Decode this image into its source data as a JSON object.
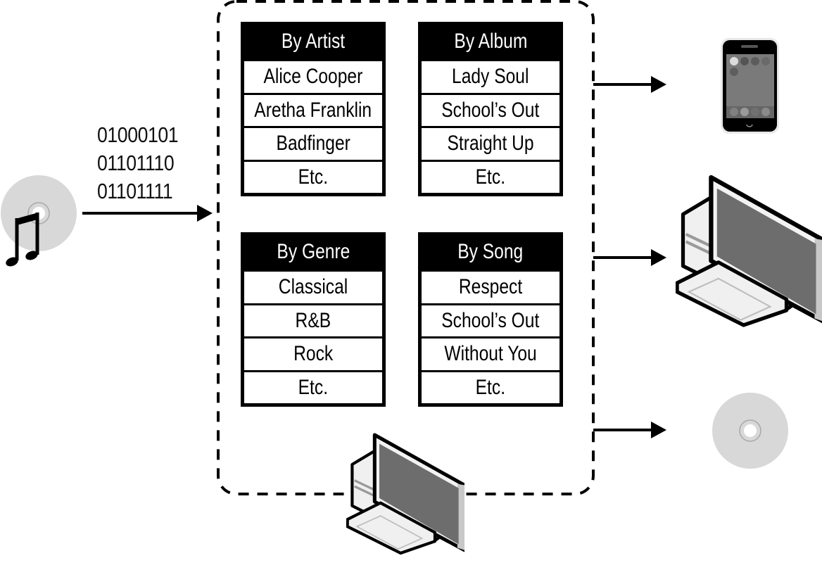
{
  "diagram": {
    "source": {
      "icon": "music-cd-icon",
      "binary_lines": [
        "01000101",
        "01101110",
        "01101111"
      ]
    },
    "library": {
      "container": "dashed-boundary",
      "computer_icon": "desktop-computer-icon",
      "indexes": [
        {
          "title": "By Artist",
          "items": [
            "Alice Cooper",
            "Aretha Franklin",
            "Badfinger",
            "Etc."
          ]
        },
        {
          "title": "By Album",
          "items": [
            "Lady Soul",
            "School’s Out",
            "Straight Up",
            "Etc."
          ]
        },
        {
          "title": "By Genre",
          "items": [
            "Classical",
            "R&B",
            "Rock",
            "Etc."
          ]
        },
        {
          "title": "By Song",
          "items": [
            "Respect",
            "School’s Out",
            "Without You",
            "Etc."
          ]
        }
      ]
    },
    "outputs": [
      {
        "icon": "smartphone-icon"
      },
      {
        "icon": "desktop-computer-icon"
      },
      {
        "icon": "cd-disc-icon"
      }
    ],
    "colors": {
      "stroke": "#000000",
      "disc": "#d8d8d8",
      "screen": "#6d6d6d",
      "case_light": "#ececec",
      "case_shade": "#9a9a9a"
    }
  }
}
